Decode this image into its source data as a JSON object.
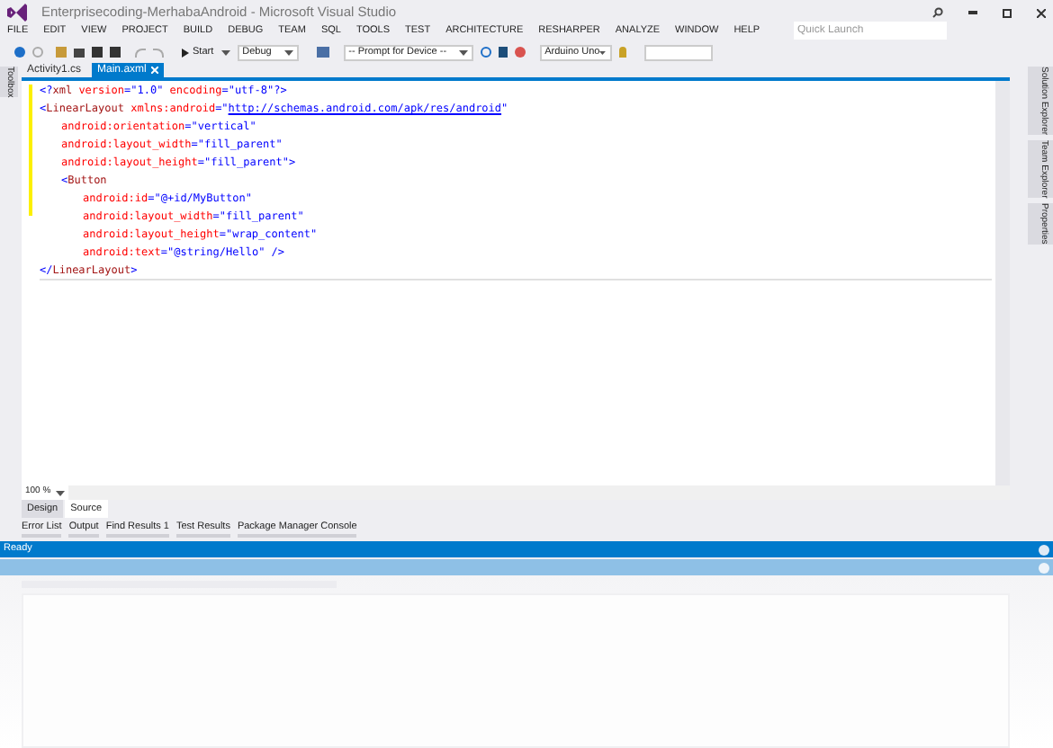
{
  "window": {
    "title": "Enterprisecoding-MerhabaAndroid - Microsoft Visual Studio",
    "quick_launch": {
      "placeholder": "Quick Launch"
    }
  },
  "menu": [
    "FILE",
    "EDIT",
    "VIEW",
    "PROJECT",
    "BUILD",
    "DEBUG",
    "TEAM",
    "SQL",
    "TOOLS",
    "TEST",
    "ARCHITECTURE",
    "RESHARPER",
    "ANALYZE",
    "WINDOW",
    "HELP"
  ],
  "toolbar": {
    "start": "Start",
    "configuration": "Debug",
    "device": "-- Prompt for Device --",
    "board": "Arduino Uno"
  },
  "left_dock": [
    "Toolbox"
  ],
  "right_dock": [
    "Solution Explorer",
    "Team Explorer",
    "Properties"
  ],
  "tabs": [
    {
      "label": "Activity1.cs",
      "selected": false
    },
    {
      "label": "Main.axml",
      "selected": true
    }
  ],
  "code": [
    {
      "tokens": [
        {
          "kind": "punct",
          "text": "<?"
        },
        {
          "kind": "tag",
          "text": "xml"
        },
        {
          "kind": "attr",
          "text": " version"
        },
        {
          "kind": "punct",
          "text": "=\""
        },
        {
          "kind": "value",
          "text": "1.0"
        },
        {
          "kind": "punct",
          "text": "\""
        },
        {
          "kind": "attr",
          "text": " encoding"
        },
        {
          "kind": "punct",
          "text": "=\""
        },
        {
          "kind": "value",
          "text": "utf-8"
        },
        {
          "kind": "punct",
          "text": "\"?>"
        }
      ]
    },
    {
      "tokens": [
        {
          "kind": "punct",
          "text": "<"
        },
        {
          "kind": "tag",
          "text": "LinearLayout"
        },
        {
          "kind": "attr",
          "text": " xmlns:android"
        },
        {
          "kind": "punct",
          "text": "=\""
        },
        {
          "kind": "link",
          "text": "http://schemas.android.com/apk/res/android"
        },
        {
          "kind": "punct",
          "text": "\""
        }
      ],
      "children": [
        {
          "tokens": [
            {
              "kind": "attr",
              "text": "android:orientation"
            },
            {
              "kind": "punct",
              "text": "=\""
            },
            {
              "kind": "value",
              "text": "vertical"
            },
            {
              "kind": "punct",
              "text": "\""
            }
          ]
        },
        {
          "tokens": [
            {
              "kind": "attr",
              "text": "android:layout_width"
            },
            {
              "kind": "punct",
              "text": "=\""
            },
            {
              "kind": "value",
              "text": "fill_parent"
            },
            {
              "kind": "punct",
              "text": "\""
            }
          ]
        },
        {
          "tokens": [
            {
              "kind": "attr",
              "text": "android:layout_height"
            },
            {
              "kind": "punct",
              "text": "=\""
            },
            {
              "kind": "value",
              "text": "fill_parent"
            },
            {
              "kind": "punct",
              "text": "\">"
            }
          ]
        },
        {
          "tokens": [
            {
              "kind": "punct",
              "text": "<"
            },
            {
              "kind": "tag",
              "text": "Button"
            }
          ],
          "children": [
            {
              "tokens": [
                {
                  "kind": "attr",
                  "text": "android:id"
                },
                {
                  "kind": "punct",
                  "text": "=\""
                },
                {
                  "kind": "value",
                  "text": "@+id/MyButton"
                },
                {
                  "kind": "punct",
                  "text": "\""
                }
              ]
            },
            {
              "tokens": [
                {
                  "kind": "attr",
                  "text": "android:layout_width"
                },
                {
                  "kind": "punct",
                  "text": "=\""
                },
                {
                  "kind": "value",
                  "text": "fill_parent"
                },
                {
                  "kind": "punct",
                  "text": "\""
                }
              ]
            },
            {
              "tokens": [
                {
                  "kind": "attr",
                  "text": "android:layout_height"
                },
                {
                  "kind": "punct",
                  "text": "=\""
                },
                {
                  "kind": "value",
                  "text": "wrap_content"
                },
                {
                  "kind": "punct",
                  "text": "\""
                }
              ]
            },
            {
              "tokens": [
                {
                  "kind": "attr",
                  "text": "android:text"
                },
                {
                  "kind": "punct",
                  "text": "=\""
                },
                {
                  "kind": "value",
                  "text": "@string/Hello"
                },
                {
                  "kind": "punct",
                  "text": "\" />"
                }
              ]
            }
          ]
        }
      ]
    },
    {
      "tokens": [
        {
          "kind": "punct",
          "text": "</"
        },
        {
          "kind": "tag",
          "text": "LinearLayout"
        },
        {
          "kind": "punct",
          "text": ">"
        }
      ]
    }
  ],
  "zoom": "100 %",
  "view_tabs": [
    {
      "label": "Design",
      "selected": false
    },
    {
      "label": "Source",
      "selected": true
    }
  ],
  "tool_tabs": [
    "Error List",
    "Output",
    "Find Results 1",
    "Test Results",
    "Package Manager Console"
  ],
  "status_bar": "Ready"
}
